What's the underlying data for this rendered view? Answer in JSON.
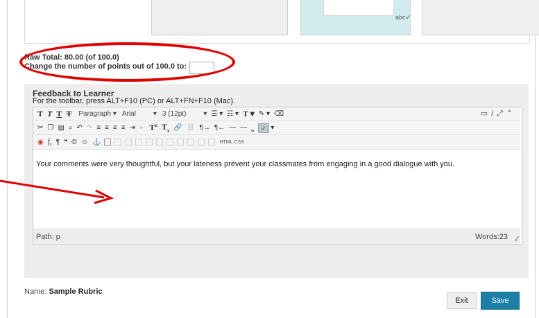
{
  "preview": {
    "spell_text": "abc"
  },
  "grade": {
    "raw_total": "Raw Total: 80.00 (of 100.0)",
    "change_label": "Change the number of points out of 100.0 to:",
    "points_value": ""
  },
  "feedback": {
    "title": "Feedback to Learner",
    "hint": "For the toolbar, press ALT+F10 (PC) or ALT+FN+F10 (Mac).",
    "toolbar": {
      "paragraph": "Paragraph",
      "font": "Arial",
      "size": "3 (12pt)",
      "html": "HTML",
      "css": "CSS"
    },
    "content": "Your comments were very thoughtful, but your lateness prevent your classmates from engaging in a good dialogue with you.",
    "path": "Path: p",
    "words": "Words:23"
  },
  "rubric": {
    "name_label": "Name:",
    "name_value": "Sample Rubric"
  },
  "buttons": {
    "exit": "Exit",
    "save": "Save"
  },
  "colors": {
    "annotation": "#e10000",
    "save_bg": "#1c7fa6"
  }
}
